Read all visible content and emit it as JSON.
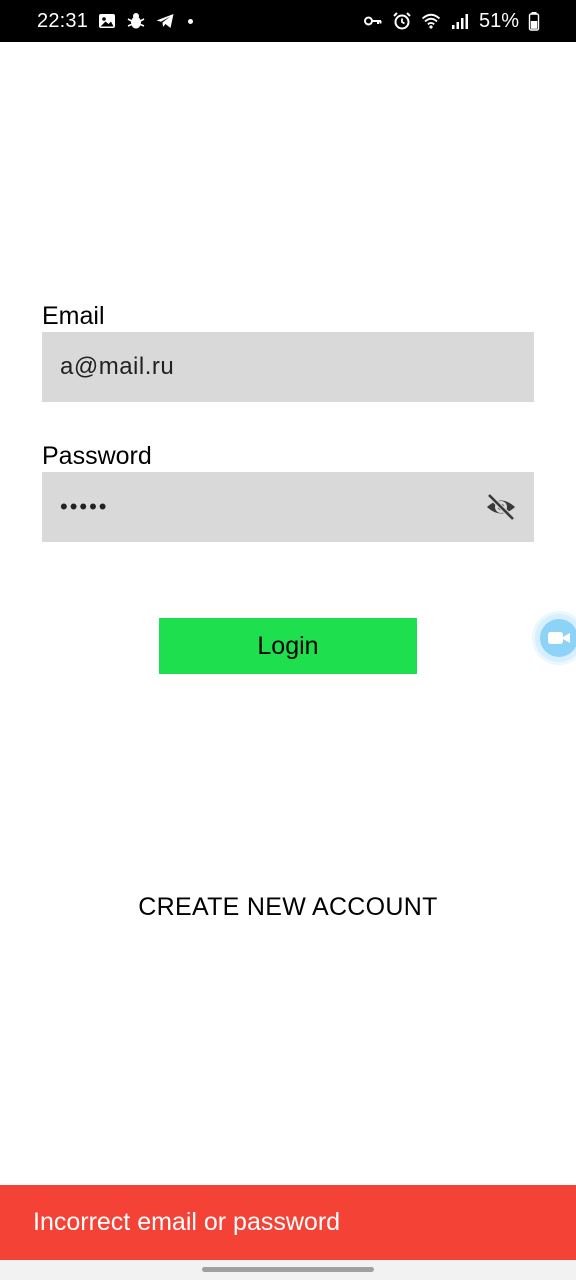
{
  "status_bar": {
    "time": "22:31",
    "left_icons": [
      "image-icon",
      "bug-icon",
      "telegram-icon",
      "dot-icon"
    ],
    "right_icons": [
      "key-icon",
      "alarm-icon",
      "wifi-icon",
      "signal-icon",
      "battery-icon"
    ],
    "battery_percent": "51%"
  },
  "form": {
    "email_label": "Email",
    "email_value": "a@mail.ru",
    "password_label": "Password",
    "password_value": "•••••",
    "password_toggle_icon": "eye-off-icon",
    "login_label": "Login",
    "create_account_label": "CREATE NEW ACCOUNT"
  },
  "floating_button": {
    "icon": "video-camera-icon"
  },
  "snackbar": {
    "message": "Incorrect email or password"
  },
  "colors": {
    "status_bar_bg": "#000000",
    "field_bg": "#d9d9d9",
    "login_button_bg": "#1ee04f",
    "snackbar_bg": "#f44336",
    "floating_button_bg": "#8dd2f7"
  }
}
